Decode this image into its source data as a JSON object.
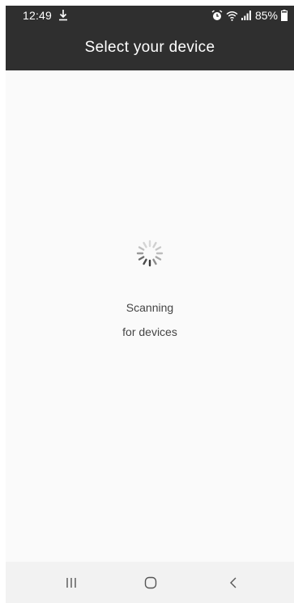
{
  "status_bar": {
    "time": "12:49",
    "battery_percent": "85%",
    "icons": [
      "download-icon",
      "alarm-icon",
      "wifi-icon",
      "signal-icon",
      "battery-icon"
    ]
  },
  "app_bar": {
    "title": "Select your device"
  },
  "main": {
    "scanning_line1": "Scanning",
    "scanning_line2": "for devices"
  },
  "nav_bar": {
    "buttons": [
      "recents-icon",
      "home-icon",
      "back-icon"
    ]
  },
  "colors": {
    "app_bar": "#2f2f2f",
    "background": "#fafafa",
    "text": "#444444",
    "nav_bar": "#f2f2f2"
  }
}
